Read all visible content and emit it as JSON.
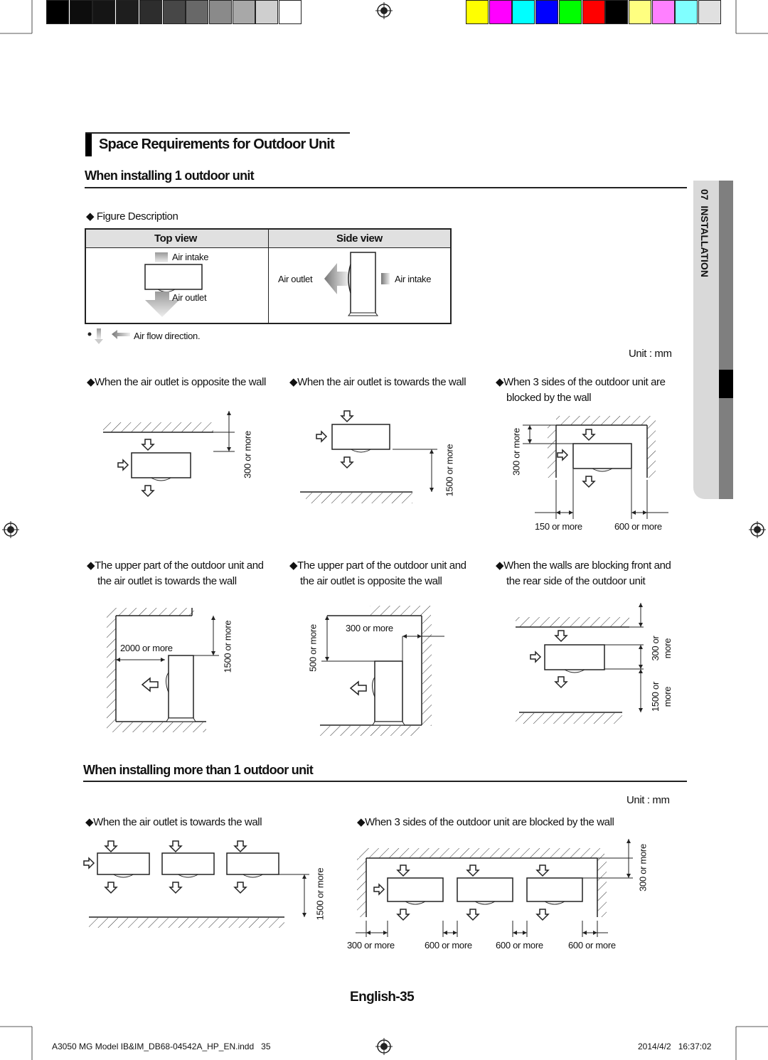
{
  "colors": {
    "gray_bar": [
      "#000000",
      "#0d0d0d",
      "#151515",
      "#1e1e1e",
      "#2d2d2d",
      "#474747",
      "#686868",
      "#8a8a8a",
      "#a8a8a8",
      "#cfcfcf",
      "#ffffff"
    ],
    "color_bar": [
      "#ffff00",
      "#ff00ff",
      "#00ffff",
      "#0000ff",
      "#00ff00",
      "#ff0000",
      "#000000",
      "#ffff80",
      "#ff80ff",
      "#80ffff",
      "#e0e0e0"
    ],
    "tab_gray": "#7f7f7f",
    "tab_light": "#d9d9d9"
  },
  "section_title": "Space Requirements for Outdoor Unit",
  "side_tab": {
    "label": "07  INSTALLATION"
  },
  "single": {
    "heading": "When installing 1 outdoor unit",
    "figure_description": "Figure Description",
    "table": {
      "top_view": "Top view",
      "side_view": "Side view",
      "air_intake": "Air intake",
      "air_outlet": "Air outlet"
    },
    "airflow_note": "Air flow direction.",
    "unit": "Unit : mm",
    "cases": [
      {
        "caption": "When the air outlet is opposite the wall",
        "dims": [
          "300 or more"
        ]
      },
      {
        "caption": "When the air outlet is towards the wall",
        "dims": [
          "1500 or more"
        ]
      },
      {
        "caption": "When 3 sides of the outdoor unit are blocked by the wall",
        "dims": [
          "300 or more",
          "150 or more",
          "600 or more"
        ]
      },
      {
        "caption": "The upper part of the outdoor unit and the air outlet is towards the wall",
        "dims": [
          "1500 or more",
          "2000 or more"
        ]
      },
      {
        "caption": "The upper part of the outdoor unit and the air outlet is opposite the wall",
        "dims": [
          "500 or more",
          "300 or more"
        ]
      },
      {
        "caption": "When the walls are blocking front and the rear side of the outdoor unit",
        "dims": [
          "300 or more",
          "1500 or more"
        ]
      }
    ]
  },
  "multi": {
    "heading": "When installing more than 1 outdoor unit",
    "unit": "Unit : mm",
    "cases": [
      {
        "caption": "When the air outlet is towards the wall",
        "dims": [
          "1500 or more"
        ]
      },
      {
        "caption": "When 3 sides of the outdoor unit are blocked by the wall",
        "dims": [
          "300 or more",
          "300 or more",
          "600 or more",
          "600 or more",
          "600 or more"
        ]
      }
    ]
  },
  "page_number": "English-35",
  "footer": {
    "file": "A3050 MG Model IB&IM_DB68-04542A_HP_EN.indd   35",
    "date": "2014/4/2   16:37:02"
  }
}
